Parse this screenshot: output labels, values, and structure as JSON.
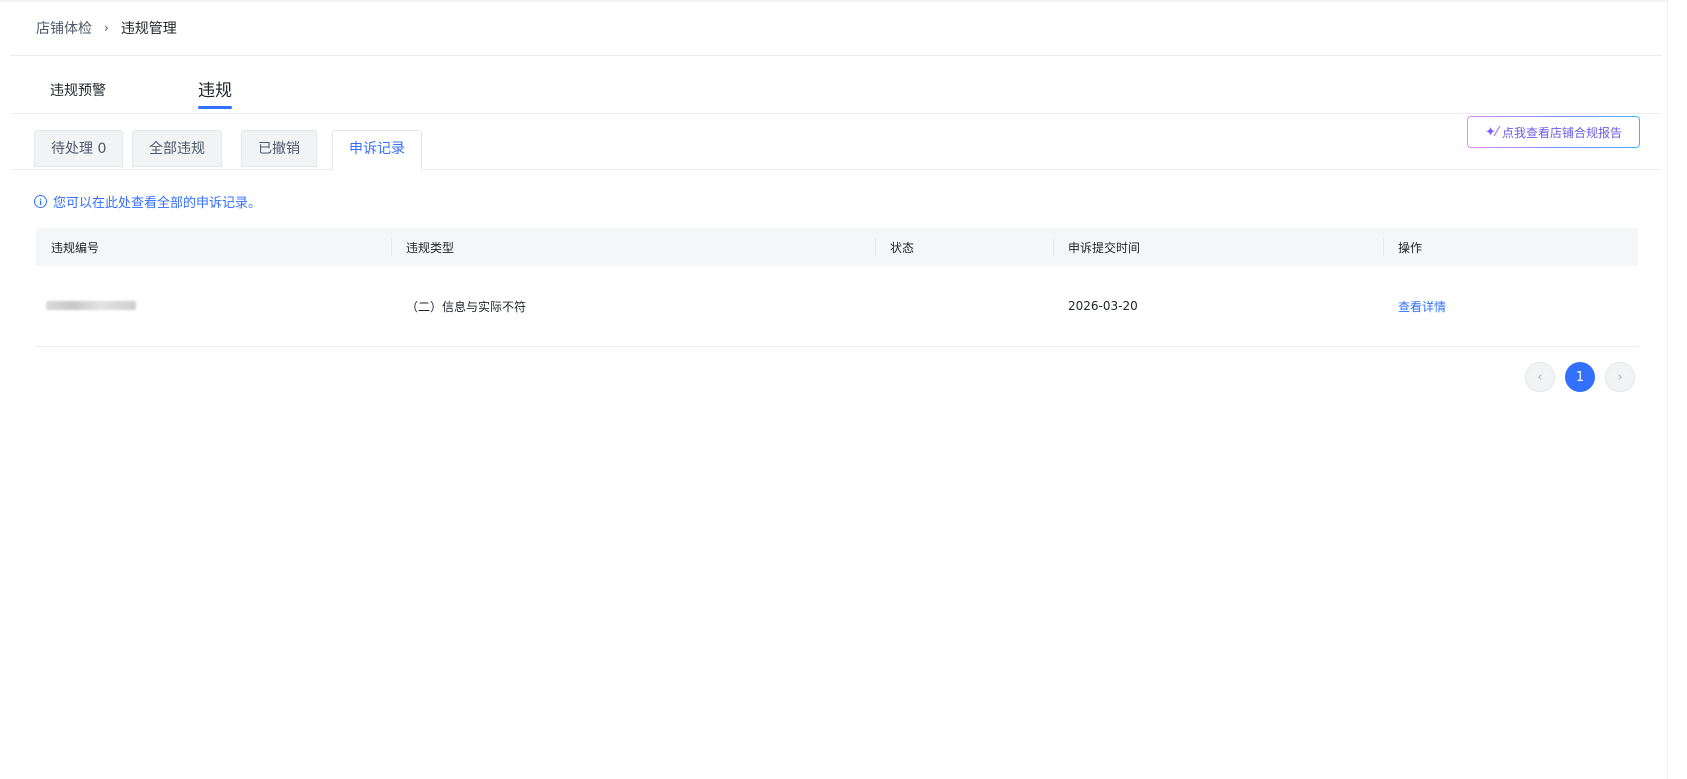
{
  "breadcrumb": {
    "items": [
      "店铺体检",
      "违规管理"
    ],
    "separator": "›"
  },
  "main_tabs": [
    {
      "label": "违规预警",
      "active": false
    },
    {
      "label": "违规",
      "active": true
    }
  ],
  "sub_tabs": [
    {
      "label": "待处理 0",
      "active": false
    },
    {
      "label": "全部违规",
      "active": false
    },
    {
      "label": "已撤销",
      "active": false
    },
    {
      "label": "申诉记录",
      "active": true
    }
  ],
  "report_button": {
    "label": "点我查看店铺合规报告",
    "icon": "sparkle-icon"
  },
  "tip": {
    "icon": "info-icon",
    "text": "您可以在此处查看全部的申诉记录。"
  },
  "table": {
    "columns": [
      "违规编号",
      "违规类型",
      "状态",
      "申诉提交时间",
      "操作"
    ],
    "rows": [
      {
        "id": "",
        "type": "（二）信息与实际不符",
        "status": "",
        "submit_time": "2026-03-20",
        "action": "查看详情"
      }
    ]
  },
  "pagination": {
    "current_page": "1",
    "prev_icon": "chevron-left-icon",
    "next_icon": "chevron-right-icon"
  },
  "colors": {
    "accent": "#3370ff",
    "header_bg": "#f5f6f7",
    "tab_bg": "#f2f3f5"
  }
}
